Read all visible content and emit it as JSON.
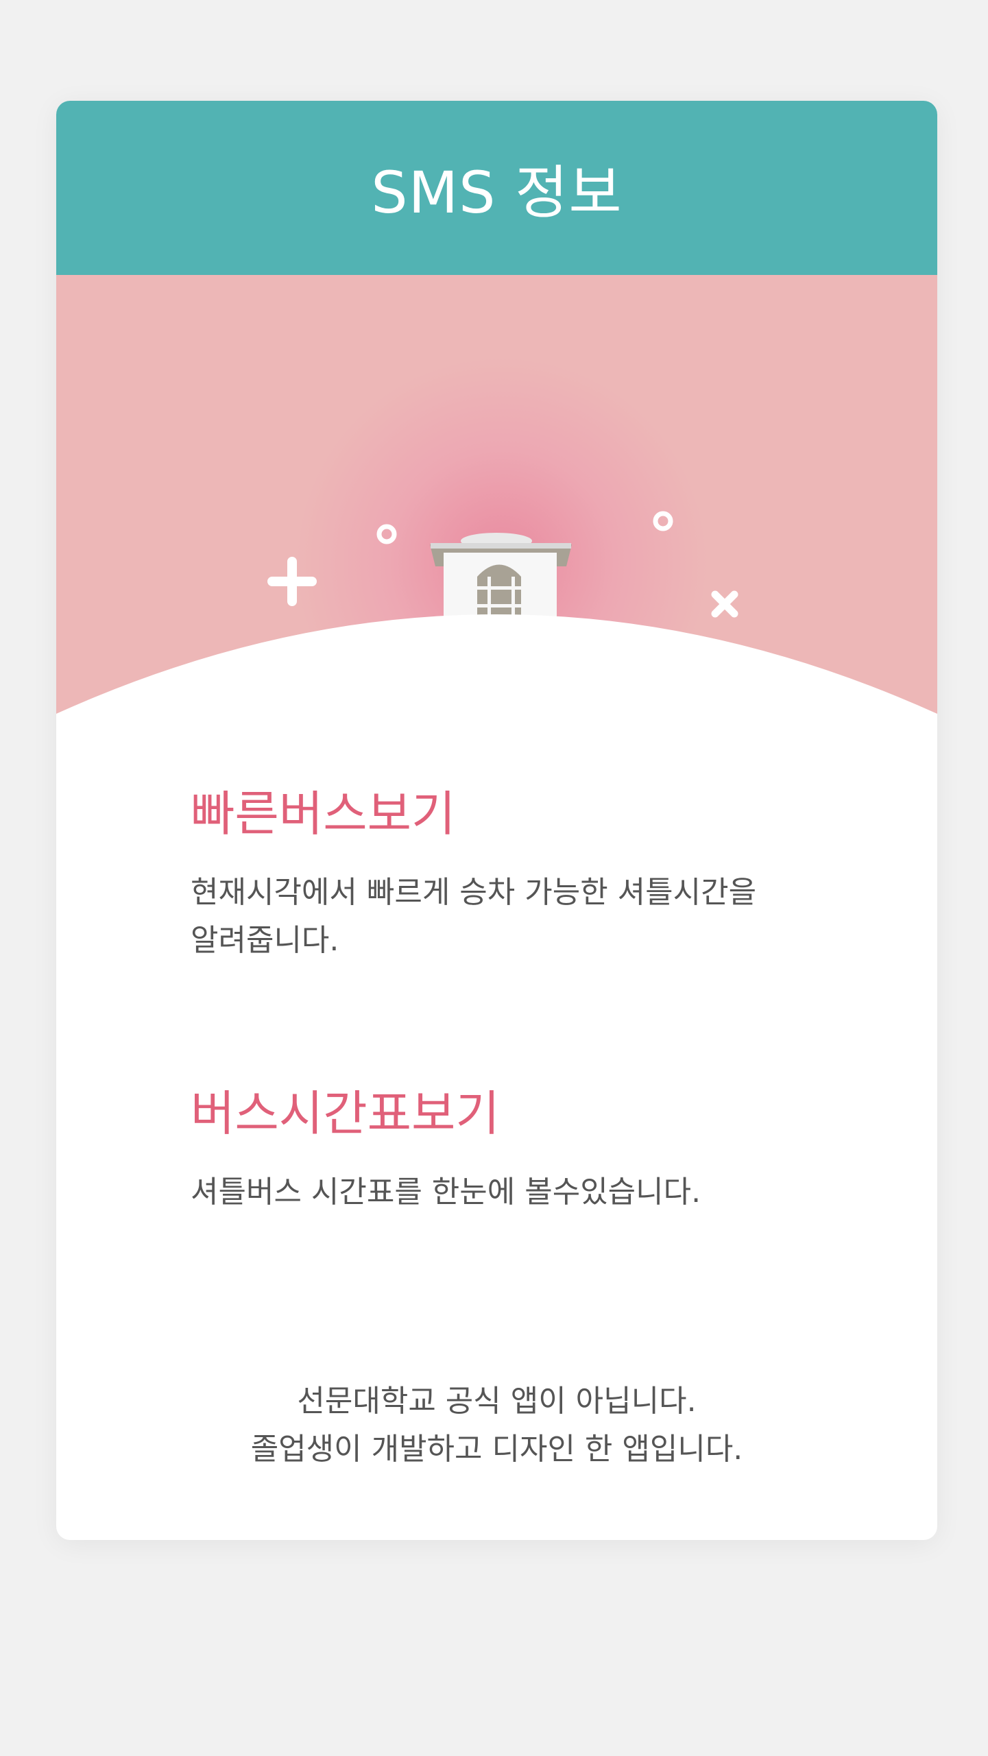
{
  "header": {
    "title": "SMS 정보"
  },
  "hero": {
    "illustration": "campus-building-illustration",
    "colors": {
      "sky": "#edb7b7",
      "glow": "#eaa0ae",
      "ground": "#ffffff",
      "lawn": "#eff3a7",
      "bushes": "#dbe22a",
      "building": "#f7f7f7",
      "windows": "#a8a295"
    }
  },
  "sections": [
    {
      "title": "빠른버스보기",
      "description_lines": [
        "현재시각에서 빠르게 승차 가능한 셔틀시간을",
        "알려줍니다."
      ]
    },
    {
      "title": "버스시간표보기",
      "description_lines": [
        "셔틀버스 시간표를 한눈에 볼수있습니다."
      ]
    }
  ],
  "footer": {
    "lines": [
      "선문대학교 공식 앱이 아닙니다.",
      "졸업생이 개발하고 디자인 한 앱입니다."
    ]
  },
  "colors": {
    "header_bg": "#52b3b3",
    "accent_pink": "#e06079",
    "text_gray": "#555555",
    "page_bg": "#f1f1f1"
  }
}
